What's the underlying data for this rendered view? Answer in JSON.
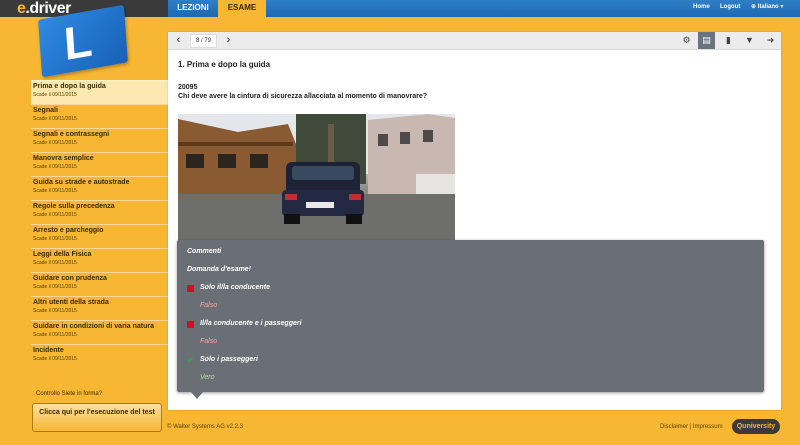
{
  "app": {
    "logo_prefix": "e",
    "logo_suffix": ".driver",
    "flag_letter": "L"
  },
  "topnav": {
    "tabs": [
      {
        "label": "LEZIONI",
        "active": false
      },
      {
        "label": "ESAME",
        "active": true
      }
    ],
    "home": "Home",
    "logout": "Logout",
    "language": "Italiano ▾"
  },
  "sidebar": {
    "items": [
      {
        "title": "Prima e dopo la guida",
        "sub": "Scade il 09/11/2015",
        "active": true
      },
      {
        "title": "Segnali",
        "sub": "Scade il 09/11/2015",
        "active": false
      },
      {
        "title": "Segnali e contrassegni",
        "sub": "Scade il 09/11/2015",
        "active": false
      },
      {
        "title": "Manovra semplice",
        "sub": "Scade il 09/11/2015",
        "active": false
      },
      {
        "title": "Guida su strade e autostrade",
        "sub": "Scade il 09/11/2015",
        "active": false
      },
      {
        "title": "Regole sulla precedenza",
        "sub": "Scade il 09/11/2015",
        "active": false
      },
      {
        "title": "Arresto e parcheggio",
        "sub": "Scade il 09/11/2015",
        "active": false
      },
      {
        "title": "Leggi della Fisica",
        "sub": "Scade il 09/11/2015",
        "active": false
      },
      {
        "title": "Guidare con prudenza",
        "sub": "Scade il 09/11/2015",
        "active": false
      },
      {
        "title": "Altri utenti della strada",
        "sub": "Scade il 09/11/2015",
        "active": false
      },
      {
        "title": "Guidare in condizioni di varia natura",
        "sub": "Scade il 09/11/2015",
        "active": false
      },
      {
        "title": "Incidente",
        "sub": "Scade il 09/11/2015",
        "active": false
      }
    ],
    "controllo": "Controllo Siete in forma?",
    "test_button": "Clicca qui per l'esecuzione del test"
  },
  "toolbar": {
    "counter": "8 / 79",
    "prev_icon": "chevron-left-icon",
    "next_icon": "chevron-right-icon",
    "tools": [
      "gear-icon",
      "comment-icon",
      "chart-icon",
      "bookmark-icon",
      "forward-icon"
    ]
  },
  "question": {
    "heading": "1. Prima e dopo la guida",
    "number": "20095",
    "text": "Chi deve avere la cintura di sicurezza allacciata al momento di manovrare?",
    "plate": "ZH 73882"
  },
  "comments": {
    "title": "Commenti",
    "subtitle": "Domanda d'esame!",
    "answers": [
      {
        "text": "Solo il/la conducente",
        "verdict": "Falso",
        "correct": false
      },
      {
        "text": "Il/la conducente e i passeggeri",
        "verdict": "Falso",
        "correct": false
      },
      {
        "text": "Solo i passeggeri",
        "verdict": "Vero",
        "correct": true
      }
    ]
  },
  "footer": {
    "copyright": "© Walter Systems AG",
    "version": "v2.2.3",
    "links": "Disclaimer | Impressum",
    "badge": "Quniversity"
  }
}
